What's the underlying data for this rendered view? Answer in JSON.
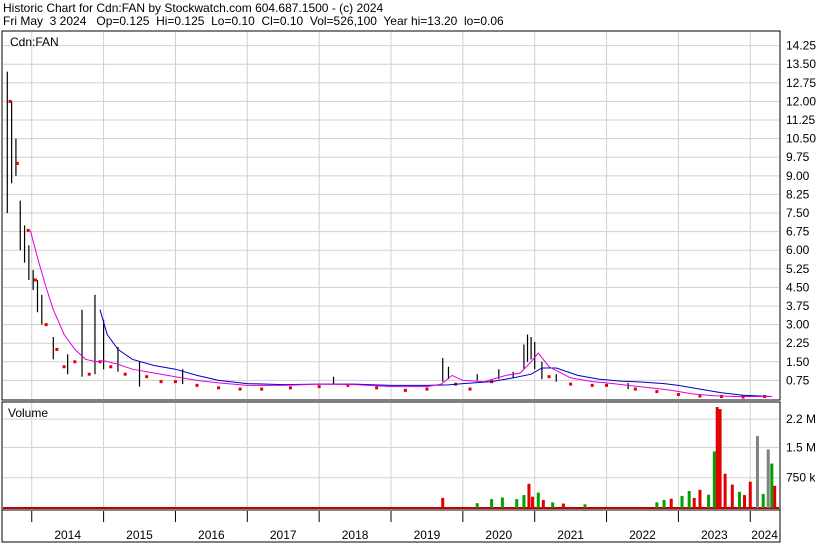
{
  "header": {
    "line1": "Historic Chart for Cdn:FAN by Stockwatch.com 604.687.1500 - (c) 2024",
    "line2": "Fri May  3 2024   Op=0.125  Hi=0.125  Lo=0.10  Cl=0.10  Vol=526,100  Year hi=13.20  lo=0.06"
  },
  "chart_data": [
    {
      "type": "line",
      "title": "Cdn:FAN",
      "ylim": [
        0,
        14.8
      ],
      "y_ticks": [
        "14.25",
        "13.50",
        "12.75",
        "12.00",
        "11.25",
        "10.50",
        "9.75",
        "9.00",
        "8.25",
        "7.50",
        "6.75",
        "6.00",
        "5.25",
        "4.50",
        "3.75",
        "3.00",
        "2.25",
        "1.50",
        "0.75"
      ],
      "y_tick_values": [
        14.25,
        13.5,
        12.75,
        12.0,
        11.25,
        10.5,
        9.75,
        9.0,
        8.25,
        7.5,
        6.75,
        6.0,
        5.25,
        4.5,
        3.75,
        3.0,
        2.25,
        1.5,
        0.75
      ],
      "x_labels": [
        "2014",
        "2015",
        "2016",
        "2017",
        "2018",
        "2019",
        "2020",
        "2021",
        "2022",
        "2023",
        "2024"
      ],
      "x_label_years": [
        2014.0,
        2015.0,
        2016.0,
        2017.0,
        2018.0,
        2019.0,
        2020.0,
        2021.0,
        2022.0,
        2023.0,
        2024.0
      ],
      "xlim": [
        2013.6,
        2024.4
      ],
      "grid": true,
      "colors": {
        "price_bar": "#000000",
        "down_marker": "#e00000",
        "ma_short": "#e000e0",
        "ma_long": "#0000c0"
      },
      "price_bars": [
        {
          "x": 2013.66,
          "hi": 13.2,
          "lo": 7.5
        },
        {
          "x": 2013.72,
          "hi": 12.0,
          "lo": 8.7
        },
        {
          "x": 2013.78,
          "hi": 10.5,
          "lo": 9.0
        },
        {
          "x": 2013.84,
          "hi": 8.0,
          "lo": 6.0
        },
        {
          "x": 2013.9,
          "hi": 7.0,
          "lo": 5.5
        },
        {
          "x": 2013.96,
          "hi": 6.2,
          "lo": 4.8
        },
        {
          "x": 2014.02,
          "hi": 5.2,
          "lo": 4.4
        },
        {
          "x": 2014.08,
          "hi": 4.8,
          "lo": 3.5
        },
        {
          "x": 2014.14,
          "hi": 4.2,
          "lo": 3.0
        },
        {
          "x": 2014.3,
          "hi": 2.5,
          "lo": 1.6
        },
        {
          "x": 2014.5,
          "hi": 1.8,
          "lo": 1.0
        },
        {
          "x": 2014.7,
          "hi": 3.6,
          "lo": 0.9
        },
        {
          "x": 2014.88,
          "hi": 4.2,
          "lo": 1.0
        },
        {
          "x": 2015.0,
          "hi": 3.2,
          "lo": 1.2
        },
        {
          "x": 2015.2,
          "hi": 2.1,
          "lo": 1.1
        },
        {
          "x": 2015.5,
          "hi": 1.5,
          "lo": 0.5
        },
        {
          "x": 2016.1,
          "hi": 1.2,
          "lo": 0.6
        },
        {
          "x": 2018.2,
          "hi": 0.9,
          "lo": 0.6
        },
        {
          "x": 2019.72,
          "hi": 1.65,
          "lo": 0.7
        },
        {
          "x": 2019.8,
          "hi": 1.3,
          "lo": 0.8
        },
        {
          "x": 2020.2,
          "hi": 1.0,
          "lo": 0.75
        },
        {
          "x": 2020.5,
          "hi": 1.2,
          "lo": 0.8
        },
        {
          "x": 2020.7,
          "hi": 1.1,
          "lo": 0.85
        },
        {
          "x": 2020.85,
          "hi": 2.2,
          "lo": 1.2
        },
        {
          "x": 2020.9,
          "hi": 2.6,
          "lo": 1.5
        },
        {
          "x": 2020.95,
          "hi": 2.5,
          "lo": 1.6
        },
        {
          "x": 2021.0,
          "hi": 2.3,
          "lo": 1.2
        },
        {
          "x": 2021.1,
          "hi": 1.5,
          "lo": 0.8
        },
        {
          "x": 2021.3,
          "hi": 1.0,
          "lo": 0.7
        },
        {
          "x": 2022.3,
          "hi": 0.65,
          "lo": 0.4
        }
      ],
      "down_markers": [
        {
          "x": 2013.7,
          "y": 12.0
        },
        {
          "x": 2013.8,
          "y": 9.5
        },
        {
          "x": 2013.95,
          "y": 6.8
        },
        {
          "x": 2014.05,
          "y": 4.8
        },
        {
          "x": 2014.2,
          "y": 3.0
        },
        {
          "x": 2014.35,
          "y": 2.0
        },
        {
          "x": 2014.45,
          "y": 1.3
        },
        {
          "x": 2014.6,
          "y": 1.5
        },
        {
          "x": 2014.8,
          "y": 1.0
        },
        {
          "x": 2014.95,
          "y": 1.5
        },
        {
          "x": 2015.1,
          "y": 1.3
        },
        {
          "x": 2015.3,
          "y": 1.0
        },
        {
          "x": 2015.6,
          "y": 0.9
        },
        {
          "x": 2015.8,
          "y": 0.7
        },
        {
          "x": 2016.0,
          "y": 0.7
        },
        {
          "x": 2016.3,
          "y": 0.55
        },
        {
          "x": 2016.6,
          "y": 0.45
        },
        {
          "x": 2016.9,
          "y": 0.4
        },
        {
          "x": 2017.2,
          "y": 0.4
        },
        {
          "x": 2017.6,
          "y": 0.45
        },
        {
          "x": 2018.0,
          "y": 0.5
        },
        {
          "x": 2018.4,
          "y": 0.55
        },
        {
          "x": 2018.8,
          "y": 0.45
        },
        {
          "x": 2019.2,
          "y": 0.35
        },
        {
          "x": 2019.5,
          "y": 0.4
        },
        {
          "x": 2019.9,
          "y": 0.6
        },
        {
          "x": 2020.1,
          "y": 0.4
        },
        {
          "x": 2020.4,
          "y": 0.7
        },
        {
          "x": 2021.2,
          "y": 0.9
        },
        {
          "x": 2021.5,
          "y": 0.6
        },
        {
          "x": 2021.8,
          "y": 0.55
        },
        {
          "x": 2022.0,
          "y": 0.55
        },
        {
          "x": 2022.4,
          "y": 0.4
        },
        {
          "x": 2022.7,
          "y": 0.3
        },
        {
          "x": 2023.0,
          "y": 0.18
        },
        {
          "x": 2023.3,
          "y": 0.12
        },
        {
          "x": 2023.6,
          "y": 0.1
        },
        {
          "x": 2023.9,
          "y": 0.08
        },
        {
          "x": 2024.2,
          "y": 0.1
        }
      ],
      "ma_short": {
        "x": [
          2013.98,
          2014.1,
          2014.2,
          2014.3,
          2014.45,
          2014.6,
          2014.75,
          2014.9,
          2015.0,
          2015.2,
          2015.4,
          2015.7,
          2016.0,
          2016.3,
          2016.6,
          2017.0,
          2017.5,
          2018.0,
          2018.5,
          2019.0,
          2019.5,
          2019.7,
          2019.85,
          2020.0,
          2020.3,
          2020.6,
          2020.8,
          2020.95,
          2021.05,
          2021.2,
          2021.5,
          2021.8,
          2022.0,
          2022.3,
          2022.6,
          2022.9,
          2023.2,
          2023.5,
          2023.8,
          2024.1,
          2024.3
        ],
        "y": [
          6.8,
          5.5,
          4.5,
          3.6,
          2.6,
          2.0,
          1.6,
          1.5,
          1.55,
          1.4,
          1.2,
          1.05,
          0.9,
          0.75,
          0.65,
          0.55,
          0.55,
          0.6,
          0.58,
          0.5,
          0.5,
          0.6,
          0.95,
          0.75,
          0.7,
          0.95,
          1.05,
          1.5,
          1.85,
          1.3,
          0.85,
          0.7,
          0.65,
          0.55,
          0.45,
          0.35,
          0.2,
          0.13,
          0.1,
          0.1,
          0.1
        ]
      },
      "ma_long": {
        "x": [
          2014.95,
          2015.05,
          2015.2,
          2015.4,
          2015.7,
          2016.0,
          2016.3,
          2016.6,
          2017.0,
          2017.5,
          2018.0,
          2018.5,
          2019.0,
          2019.5,
          2019.8,
          2020.0,
          2020.4,
          2020.7,
          2020.95,
          2021.1,
          2021.3,
          2021.6,
          2021.9,
          2022.2,
          2022.5,
          2022.8,
          2023.0,
          2023.3,
          2023.6,
          2023.9,
          2024.3
        ],
        "y": [
          3.6,
          2.6,
          2.0,
          1.6,
          1.35,
          1.2,
          0.95,
          0.75,
          0.62,
          0.58,
          0.6,
          0.6,
          0.55,
          0.55,
          0.57,
          0.62,
          0.7,
          0.85,
          1.0,
          1.25,
          1.25,
          0.95,
          0.8,
          0.72,
          0.68,
          0.62,
          0.55,
          0.4,
          0.25,
          0.15,
          0.1
        ]
      }
    },
    {
      "type": "bar",
      "title": "Volume",
      "ylim": [
        0,
        2600000
      ],
      "y_ticks": [
        "2.2 M",
        "1.5 M",
        "750 k"
      ],
      "y_tick_values": [
        2200000,
        1500000,
        750000
      ],
      "xlim": [
        2013.6,
        2024.4
      ],
      "colors": {
        "up": "#00a000",
        "down": "#e00000",
        "unchanged": "#808080",
        "baseline": "#c00000"
      },
      "bars": [
        {
          "x": 2019.72,
          "v": 250000,
          "c": "down"
        },
        {
          "x": 2020.2,
          "v": 120000,
          "c": "up"
        },
        {
          "x": 2020.4,
          "v": 220000,
          "c": "up"
        },
        {
          "x": 2020.55,
          "v": 260000,
          "c": "up"
        },
        {
          "x": 2020.75,
          "v": 220000,
          "c": "up"
        },
        {
          "x": 2020.85,
          "v": 320000,
          "c": "up"
        },
        {
          "x": 2020.92,
          "v": 600000,
          "c": "down"
        },
        {
          "x": 2020.97,
          "v": 280000,
          "c": "down"
        },
        {
          "x": 2021.05,
          "v": 380000,
          "c": "up"
        },
        {
          "x": 2021.12,
          "v": 200000,
          "c": "down"
        },
        {
          "x": 2021.25,
          "v": 140000,
          "c": "up"
        },
        {
          "x": 2021.4,
          "v": 110000,
          "c": "down"
        },
        {
          "x": 2021.7,
          "v": 90000,
          "c": "up"
        },
        {
          "x": 2022.7,
          "v": 140000,
          "c": "up"
        },
        {
          "x": 2022.8,
          "v": 200000,
          "c": "up"
        },
        {
          "x": 2022.9,
          "v": 230000,
          "c": "down"
        },
        {
          "x": 2023.05,
          "v": 300000,
          "c": "up"
        },
        {
          "x": 2023.15,
          "v": 420000,
          "c": "up"
        },
        {
          "x": 2023.22,
          "v": 250000,
          "c": "down"
        },
        {
          "x": 2023.3,
          "v": 450000,
          "c": "down"
        },
        {
          "x": 2023.42,
          "v": 330000,
          "c": "up"
        },
        {
          "x": 2023.5,
          "v": 1400000,
          "c": "up"
        },
        {
          "x": 2023.54,
          "v": 2500000,
          "c": "down"
        },
        {
          "x": 2023.58,
          "v": 2450000,
          "c": "down"
        },
        {
          "x": 2023.65,
          "v": 850000,
          "c": "down"
        },
        {
          "x": 2023.75,
          "v": 580000,
          "c": "down"
        },
        {
          "x": 2023.85,
          "v": 400000,
          "c": "up"
        },
        {
          "x": 2023.92,
          "v": 320000,
          "c": "down"
        },
        {
          "x": 2024.0,
          "v": 650000,
          "c": "down"
        },
        {
          "x": 2024.1,
          "v": 1780000,
          "c": "unchanged"
        },
        {
          "x": 2024.18,
          "v": 350000,
          "c": "up"
        },
        {
          "x": 2024.25,
          "v": 1450000,
          "c": "unchanged"
        },
        {
          "x": 2024.3,
          "v": 1100000,
          "c": "up"
        },
        {
          "x": 2024.34,
          "v": 550000,
          "c": "down"
        }
      ]
    }
  ]
}
